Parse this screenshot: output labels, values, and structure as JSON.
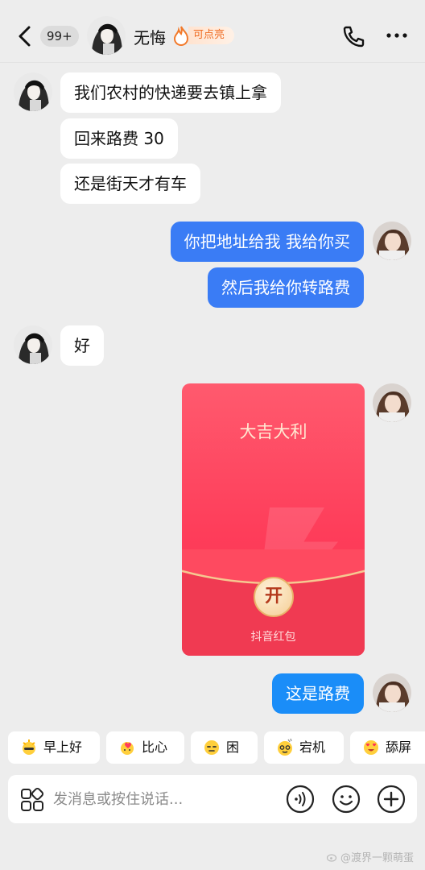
{
  "header": {
    "unread_count": "99+",
    "contact_name": "无悔",
    "spark_label": "可点亮"
  },
  "messages": [
    {
      "side": "in",
      "text": "我们农村的快递要去镇上拿"
    },
    {
      "side": "in",
      "text": "回来路费 30"
    },
    {
      "side": "in",
      "text": "还是街天才有车"
    },
    {
      "side": "out",
      "text": "你把地址给我 我给你买"
    },
    {
      "side": "out",
      "text": "然后我给你转路费"
    },
    {
      "side": "in",
      "text": "好"
    },
    {
      "side": "out",
      "type": "red-packet",
      "title": "大吉大利",
      "open_label": "开",
      "brand": "抖音红包"
    },
    {
      "side": "out",
      "text": "这是路费"
    }
  ],
  "quick_replies": [
    {
      "icon": "sun-emoji-icon",
      "label": "早上好"
    },
    {
      "icon": "heart-hands-emoji-icon",
      "label": "比心"
    },
    {
      "icon": "sleepy-emoji-icon",
      "label": "困"
    },
    {
      "icon": "crashed-emoji-icon",
      "label": "宕机"
    },
    {
      "icon": "heart-eyes-emoji-icon",
      "label": "舔屏"
    }
  ],
  "input": {
    "placeholder": "发消息或按住说话..."
  },
  "watermark": "@渡界一颗萌蛋",
  "colors": {
    "background": "#ededed",
    "outgoing_bubble": "#3a7cf5",
    "incoming_bubble": "#ffffff",
    "red_packet": "#fe3d5a",
    "spark_accent": "#ef6c22"
  }
}
